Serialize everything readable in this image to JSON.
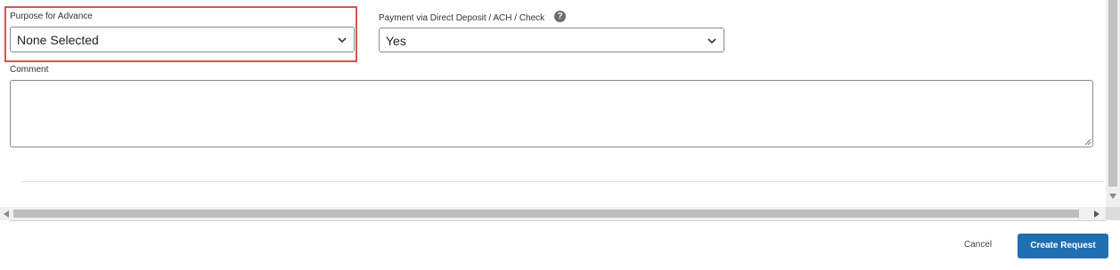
{
  "form": {
    "purpose": {
      "label": "Purpose for Advance",
      "value": "None Selected",
      "highlight_color": "#d9534f"
    },
    "payment": {
      "label": "Payment via Direct Deposit / ACH / Check",
      "value": "Yes",
      "help_icon": "question-circle-icon",
      "help_glyph": "?"
    },
    "comment": {
      "label": "Comment",
      "value": ""
    }
  },
  "footer": {
    "cancel_label": "Cancel",
    "submit_label": "Create Request"
  },
  "colors": {
    "primary": "#1f6fb2",
    "highlight": "#d9534f",
    "border": "#8a8a8a"
  }
}
